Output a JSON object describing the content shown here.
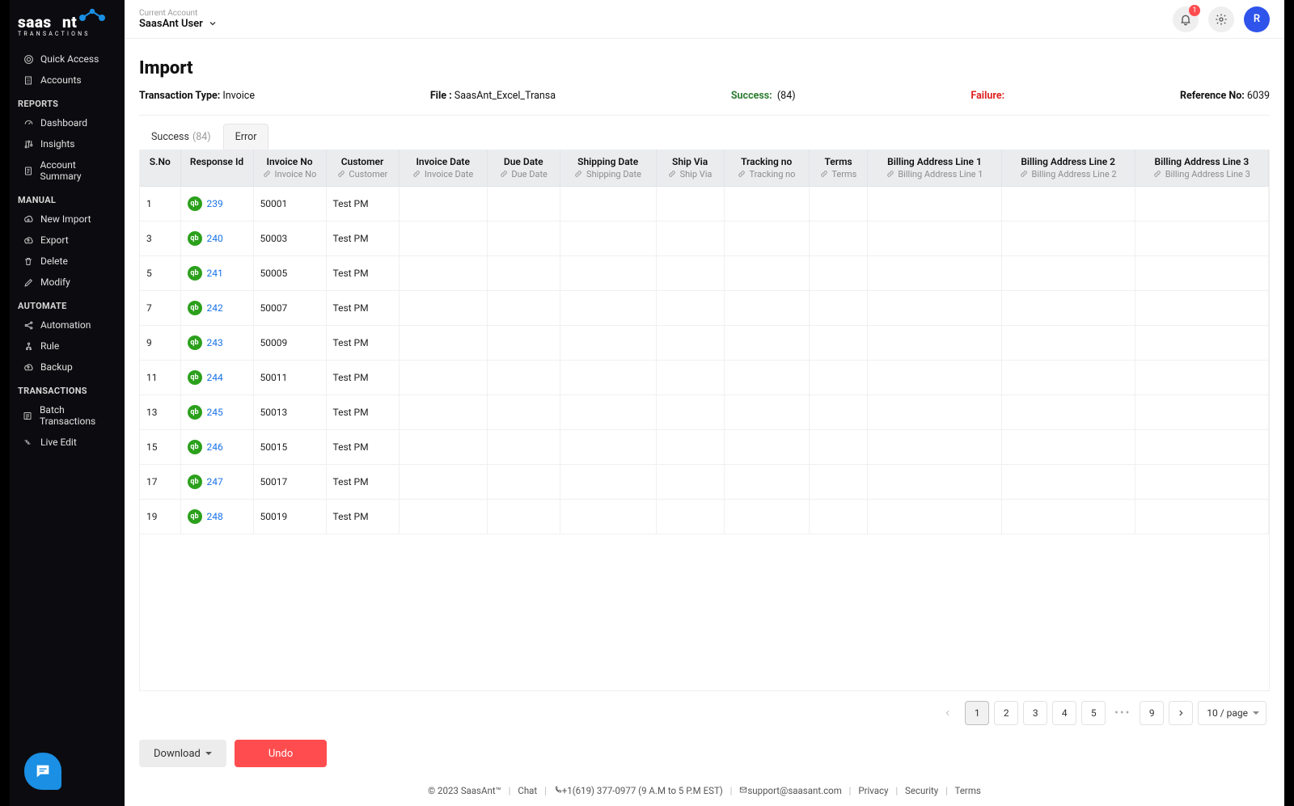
{
  "header": {
    "current_account_label": "Current Account",
    "account_name": "SaasAnt User",
    "notification_count": "1",
    "profile_initial": "R"
  },
  "sidebar": {
    "items_top": [
      {
        "icon": "target",
        "label": "Quick Access"
      },
      {
        "icon": "building",
        "label": "Accounts"
      }
    ],
    "sections": [
      {
        "title": "REPORTS",
        "items": [
          {
            "icon": "gauge",
            "label": "Dashboard"
          },
          {
            "icon": "sliders",
            "label": "Insights"
          },
          {
            "icon": "doc",
            "label": "Account Summary"
          }
        ]
      },
      {
        "title": "MANUAL",
        "items": [
          {
            "icon": "plus-cloud",
            "label": "New Import"
          },
          {
            "icon": "up-cloud",
            "label": "Export"
          },
          {
            "icon": "trash",
            "label": "Delete"
          },
          {
            "icon": "pencil",
            "label": "Modify"
          }
        ]
      },
      {
        "title": "AUTOMATE",
        "items": [
          {
            "icon": "share",
            "label": "Automation"
          },
          {
            "icon": "rule",
            "label": "Rule"
          },
          {
            "icon": "cloud-up",
            "label": "Backup"
          }
        ]
      },
      {
        "title": "TRANSACTIONS",
        "items": [
          {
            "icon": "list",
            "label": "Batch Transactions"
          },
          {
            "icon": "live",
            "label": "Live Edit"
          }
        ]
      }
    ]
  },
  "page": {
    "title": "Import",
    "meta": {
      "txn_type_label": "Transaction Type:",
      "txn_type_value": "Invoice",
      "file_label": "File :",
      "file_value": "SaasAnt_Excel_Transa",
      "success_label": "Success:",
      "success_value": "(84)",
      "failure_label": "Failure:",
      "failure_value": "",
      "ref_label": "Reference No:",
      "ref_value": "6039"
    },
    "tabs": {
      "success_label": "Success",
      "success_count": "(84)",
      "error_label": "Error"
    },
    "columns": [
      {
        "head": "S.No",
        "sub": ""
      },
      {
        "head": "Response Id",
        "sub": ""
      },
      {
        "head": "Invoice No",
        "sub": "Invoice No"
      },
      {
        "head": "Customer",
        "sub": "Customer"
      },
      {
        "head": "Invoice Date",
        "sub": "Invoice Date"
      },
      {
        "head": "Due Date",
        "sub": "Due Date"
      },
      {
        "head": "Shipping Date",
        "sub": "Shipping Date"
      },
      {
        "head": "Ship Via",
        "sub": "Ship Via"
      },
      {
        "head": "Tracking no",
        "sub": "Tracking no"
      },
      {
        "head": "Terms",
        "sub": "Terms"
      },
      {
        "head": "Billing Address Line 1",
        "sub": "Billing Address Line 1"
      },
      {
        "head": "Billing Address Line 2",
        "sub": "Billing Address Line 2"
      },
      {
        "head": "Billing Address Line 3",
        "sub": "Billing Address Line 3"
      }
    ],
    "rows": [
      {
        "sno": "1",
        "resp": "239",
        "inv": "50001",
        "cust": "Test PM"
      },
      {
        "sno": "3",
        "resp": "240",
        "inv": "50003",
        "cust": "Test PM"
      },
      {
        "sno": "5",
        "resp": "241",
        "inv": "50005",
        "cust": "Test PM"
      },
      {
        "sno": "7",
        "resp": "242",
        "inv": "50007",
        "cust": "Test PM"
      },
      {
        "sno": "9",
        "resp": "243",
        "inv": "50009",
        "cust": "Test PM"
      },
      {
        "sno": "11",
        "resp": "244",
        "inv": "50011",
        "cust": "Test PM"
      },
      {
        "sno": "13",
        "resp": "245",
        "inv": "50013",
        "cust": "Test PM"
      },
      {
        "sno": "15",
        "resp": "246",
        "inv": "50015",
        "cust": "Test PM"
      },
      {
        "sno": "17",
        "resp": "247",
        "inv": "50017",
        "cust": "Test PM"
      },
      {
        "sno": "19",
        "resp": "248",
        "inv": "50019",
        "cust": "Test PM"
      }
    ],
    "pagination": {
      "pages": [
        "1",
        "2",
        "3",
        "4",
        "5"
      ],
      "ellipsis": "•••",
      "last": "9",
      "page_size_label": "10 / page"
    },
    "actions": {
      "download": "Download",
      "undo": "Undo"
    }
  },
  "footer": {
    "copyright": "© 2023 SaasAnt™",
    "chat": "Chat",
    "phone": "+1(619) 377-0977 (9 A.M to 5 P.M EST)",
    "email": "support@saasant.com",
    "privacy": "Privacy",
    "security": "Security",
    "terms": "Terms"
  }
}
